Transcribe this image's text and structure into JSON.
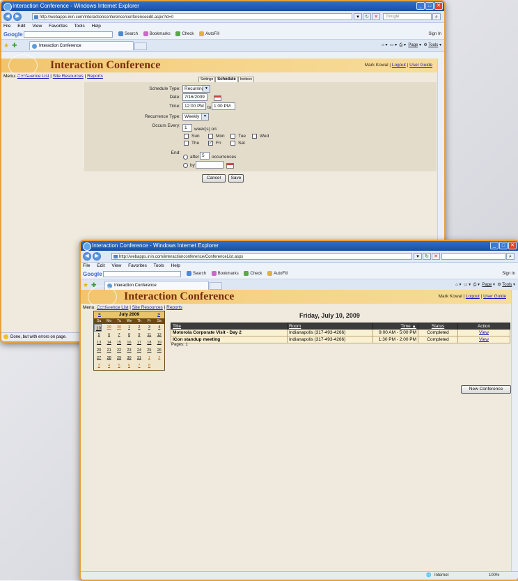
{
  "colors": {
    "accent_orange": "#e8a03a",
    "titlebar_blue": "#1b4fa2",
    "banner": "#f5d287",
    "title_text": "#7a2e0c",
    "form_bg": "#e3dccb"
  },
  "window1": {
    "title": "Interaction Conference - Windows Internet Explorer",
    "address": "http://webapps.inin.com/interactionconference/conferenceedit.aspx?id=0",
    "search_placeholder": "Google",
    "menu": [
      "File",
      "Edit",
      "View",
      "Favorites",
      "Tools",
      "Help"
    ],
    "google_logo": "Google",
    "google_tools": [
      "Search",
      "Bookmarks",
      "Check",
      "AutoFill"
    ],
    "signin": "Sign In",
    "tab_label": "Interaction Conference",
    "cmd": [
      "Page",
      "Tools"
    ],
    "app_title": "Interaction Conference",
    "user": "Mark Kowal",
    "logout": "Logout",
    "user_guide": "User Guide",
    "menu_prefix": "Menu:",
    "nav": [
      "Conference List",
      "Site Resources",
      "Reports"
    ],
    "form_tabs": [
      "Settings",
      "Schedule",
      "Invitees"
    ],
    "form": {
      "schedule_type_label": "Schedule Type:",
      "schedule_type": "Recurring",
      "date_label": "Date:",
      "date": "7/16/2009",
      "time_label": "Time:",
      "time_from": "12:00 PM",
      "to": "to",
      "time_to": "1:00 PM",
      "recurrence_label": "Recurrence Type:",
      "recurrence": "Weekly",
      "occurs_label": "Occurs Every:",
      "occurs_value": "1",
      "occurs_suffix": "week(s) on:",
      "days": [
        {
          "label": "Sun",
          "checked": false
        },
        {
          "label": "Mon",
          "checked": false
        },
        {
          "label": "Tue",
          "checked": false
        },
        {
          "label": "Wed",
          "checked": false
        },
        {
          "label": "Thu",
          "checked": false
        },
        {
          "label": "Fri",
          "checked": true
        },
        {
          "label": "Sat",
          "checked": false
        }
      ],
      "end_label": "End:",
      "after_label": "after",
      "after_value": "5",
      "occurrences": "occurrences",
      "by_label": "by",
      "cancel": "Cancel",
      "save": "Save"
    },
    "status": "Done, but with errors on page."
  },
  "window2": {
    "title": "Interaction Conference - Windows Internet Explorer",
    "address": "http://webapps.inin.com/interactionconference/ConferenceList.aspx",
    "menu": [
      "File",
      "Edit",
      "View",
      "Favorites",
      "Tools",
      "Help"
    ],
    "google_logo": "Google",
    "google_tools": [
      "Search",
      "Bookmarks",
      "Check",
      "AutoFill"
    ],
    "signin": "Sign In",
    "tab_label": "Interaction Conference",
    "cmd": [
      "Page",
      "Tools"
    ],
    "app_title": "Interaction Conference",
    "user": "Mark Kowal",
    "logout": "Logout",
    "user_guide": "User Guide",
    "menu_prefix": "Menu:",
    "nav": [
      "Conference List",
      "Site Resources",
      "Reports"
    ],
    "calendar": {
      "prev": "<",
      "month": "July 2009",
      "next": ">",
      "dow": [
        "Su",
        "Mo",
        "Tu",
        "We",
        "Th",
        "Fr",
        "Sa"
      ],
      "days": [
        "28",
        "29",
        "30",
        "1",
        "2",
        "3",
        "4",
        "5",
        "6",
        "7",
        "8",
        "9",
        "10",
        "11",
        "12",
        "13",
        "14",
        "15",
        "16",
        "17",
        "18",
        "19",
        "20",
        "21",
        "22",
        "23",
        "24",
        "25",
        "26",
        "27",
        "28",
        "29",
        "30",
        "31",
        "1",
        "2",
        "3",
        "4",
        "5",
        "6",
        "7",
        "8"
      ]
    },
    "day_heading": "Friday, July 10, 2009",
    "table": {
      "headers": [
        "Title",
        "Room",
        "Time ▲",
        "Status",
        "Action"
      ],
      "rows": [
        {
          "title": "Motorola Corporate Visit - Day 2",
          "room": "Indianapolis (317-493-4266)",
          "time": "9:00 AM - 5:00 PM",
          "status": "Completed",
          "action": "View"
        },
        {
          "title": "ICon standup meeting",
          "room": "Indianapolis (317-493-4266)",
          "time": "1:30 PM - 2:00 PM",
          "status": "Completed",
          "action": "View"
        }
      ]
    },
    "pages": "Pages: 1",
    "new_conference": "New Conference",
    "status_zone": "Internet",
    "zoom": "100%"
  }
}
